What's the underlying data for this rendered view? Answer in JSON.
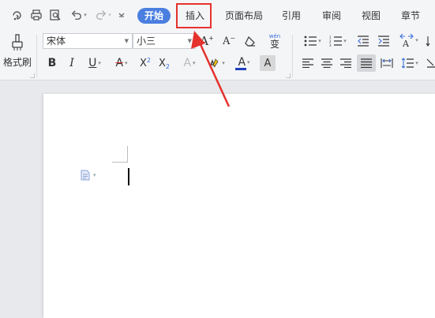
{
  "tabs": {
    "start": "开始",
    "insert": "插入",
    "page_layout": "页面布局",
    "references": "引用",
    "review": "审阅",
    "view": "视图",
    "chapter": "章节"
  },
  "ribbon": {
    "format_painter_label": "格式刷",
    "font_name": "宋体",
    "font_size": "小三",
    "phonetic_label": "wén",
    "phonetic_char": "变"
  },
  "colors": {
    "active_tab": "#4a7fe0",
    "highlight_box": "#e5322d",
    "font_color_bar": "#1f3fbf"
  },
  "icons": [
    "save-icon",
    "print-icon",
    "print-preview-icon",
    "undo-icon",
    "redo-icon",
    "customize-toolbar-icon",
    "format-painter-icon",
    "bold-icon",
    "italic-icon",
    "underline-icon",
    "strikethrough-icon",
    "superscript-icon",
    "subscript-icon",
    "text-effect-icon",
    "highlight-icon",
    "font-color-icon",
    "char-shading-icon",
    "grow-font-icon",
    "shrink-font-icon",
    "clear-format-icon",
    "bullets-icon",
    "numbering-icon",
    "decrease-indent-icon",
    "increase-indent-icon",
    "text-direction-icon",
    "align-left-icon",
    "align-center-icon",
    "align-right-icon",
    "justify-icon",
    "distributed-icon",
    "line-spacing-icon",
    "paragraph-marker-icon"
  ]
}
